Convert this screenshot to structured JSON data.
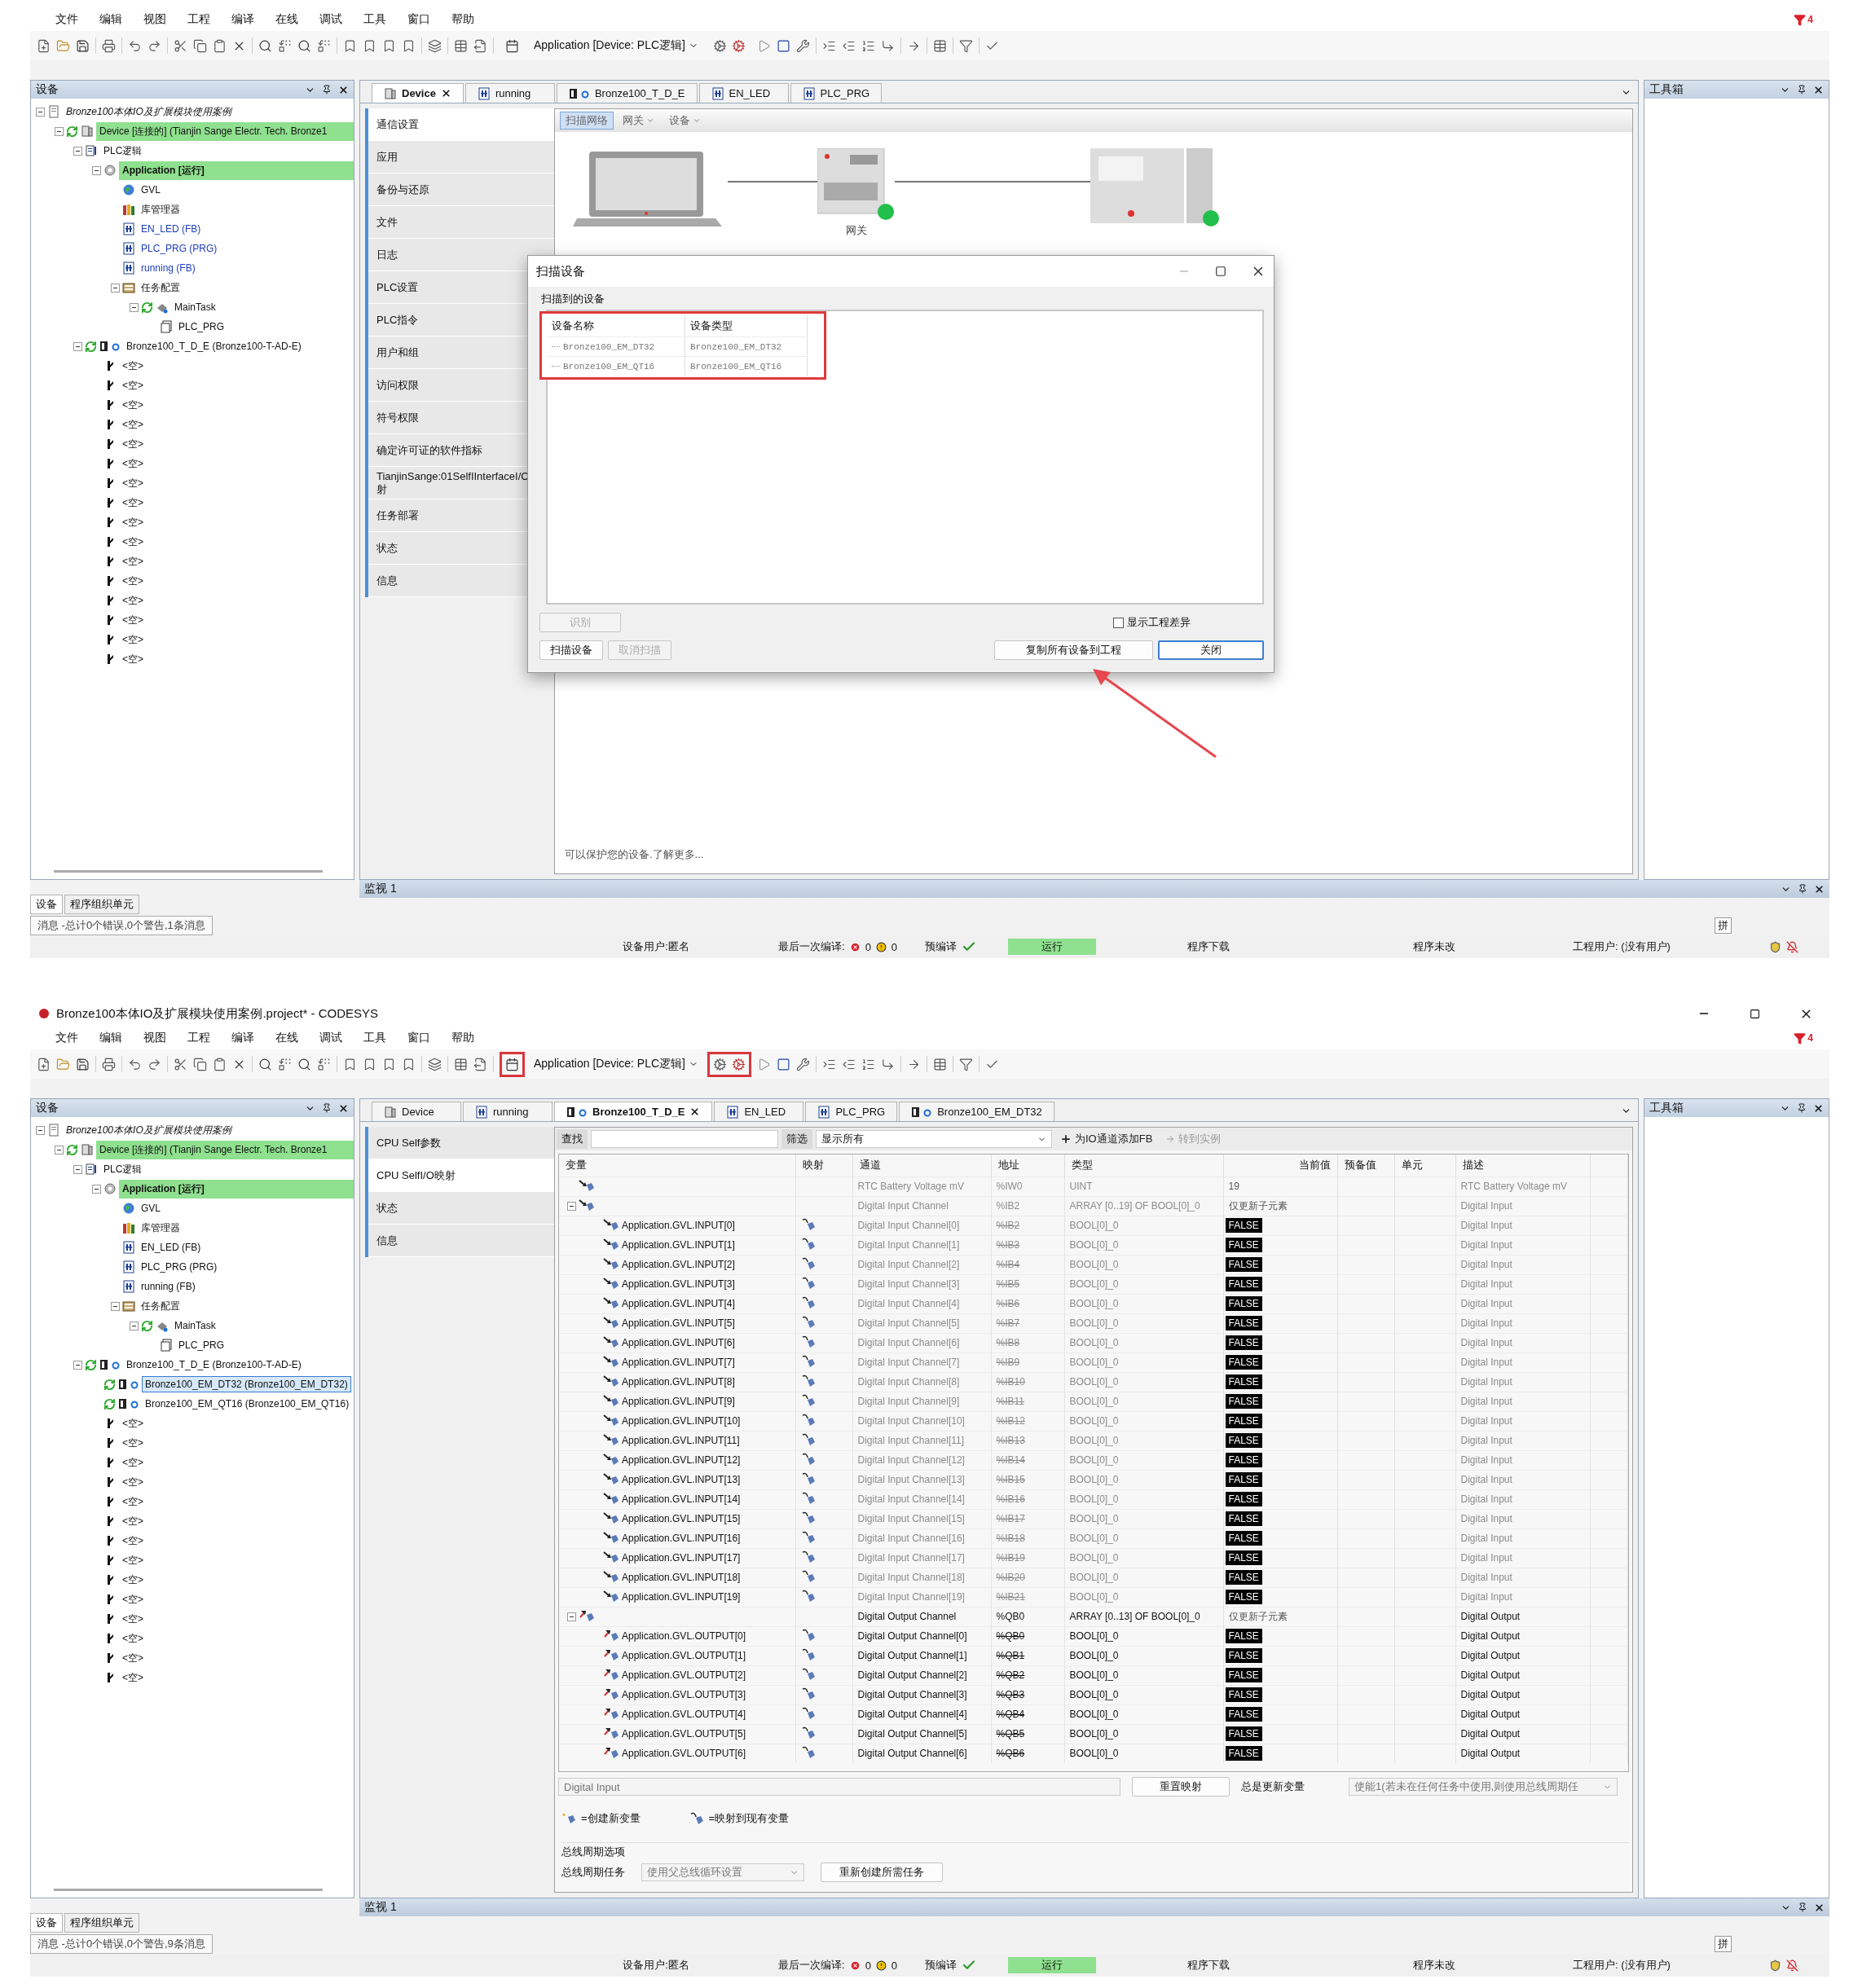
{
  "screens": [
    {
      "menu": [
        "文件",
        "编辑",
        "视图",
        "工程",
        "编译",
        "在线",
        "调试",
        "工具",
        "窗口",
        "帮助"
      ],
      "filter_badge": "4",
      "toolbar": {
        "application": "Application [Device: PLC逻辑]",
        "device_button_highlighted": false,
        "login_buttons_highlighted": false
      },
      "devices_panel": {
        "title": "设备",
        "tree": [
          {
            "label": "Bronze100本体IO及扩展模块使用案例",
            "kind": "project",
            "online": false,
            "highlighted": false,
            "selected": false,
            "children": [
              {
                "label": "Device [连接的] (Tianjin Sange Electr. Tech. Bronze1",
                "kind": "device",
                "online": true,
                "highlighted": true,
                "selected": false,
                "children": [
                  {
                    "label": "PLC逻辑",
                    "kind": "plc",
                    "online": false,
                    "highlighted": false,
                    "selected": false,
                    "children": [
                      {
                        "label": "Application [运行]",
                        "kind": "app",
                        "online": false,
                        "highlighted": true,
                        "selected": false,
                        "children": [
                          {
                            "label": "GVL",
                            "kind": "gvl",
                            "online": false,
                            "highlighted": false,
                            "selected": false
                          },
                          {
                            "label": "库管理器",
                            "kind": "lib",
                            "online": false,
                            "highlighted": false,
                            "selected": false
                          },
                          {
                            "label": "EN_LED (FB)",
                            "kind": "pou",
                            "online": false,
                            "highlighted": false,
                            "selected": false,
                            "color": "#1f3fbf"
                          },
                          {
                            "label": "PLC_PRG (PRG)",
                            "kind": "pou",
                            "online": false,
                            "highlighted": false,
                            "selected": false,
                            "color": "#1f3fbf"
                          },
                          {
                            "label": "running (FB)",
                            "kind": "pou",
                            "online": false,
                            "highlighted": false,
                            "selected": false,
                            "color": "#1f3fbf"
                          },
                          {
                            "label": "任务配置",
                            "kind": "taskcfg",
                            "online": false,
                            "highlighted": false,
                            "selected": false,
                            "children": [
                              {
                                "label": "MainTask",
                                "kind": "task",
                                "online": true,
                                "highlighted": false,
                                "selected": false,
                                "children": [
                                  {
                                    "label": "PLC_PRG",
                                    "kind": "prg",
                                    "online": false,
                                    "highlighted": false,
                                    "selected": false
                                  }
                                ]
                              }
                            ]
                          }
                        ]
                      }
                    ]
                  },
                  {
                    "label": "Bronze100_T_D_E (Bronze100-T-AD-E)",
                    "kind": "module",
                    "online": true,
                    "highlighted": false,
                    "selected": false,
                    "children": [
                      {
                        "label": "<空>",
                        "kind": "slot",
                        "online": false,
                        "highlighted": false,
                        "selected": false
                      },
                      {
                        "label": "<空>",
                        "kind": "slot",
                        "online": false,
                        "highlighted": false,
                        "selected": false
                      },
                      {
                        "label": "<空>",
                        "kind": "slot",
                        "online": false,
                        "highlighted": false,
                        "selected": false
                      },
                      {
                        "label": "<空>",
                        "kind": "slot",
                        "online": false,
                        "highlighted": false,
                        "selected": false
                      },
                      {
                        "label": "<空>",
                        "kind": "slot",
                        "online": false,
                        "highlighted": false,
                        "selected": false
                      },
                      {
                        "label": "<空>",
                        "kind": "slot",
                        "online": false,
                        "highlighted": false,
                        "selected": false
                      },
                      {
                        "label": "<空>",
                        "kind": "slot",
                        "online": false,
                        "highlighted": false,
                        "selected": false
                      },
                      {
                        "label": "<空>",
                        "kind": "slot",
                        "online": false,
                        "highlighted": false,
                        "selected": false
                      },
                      {
                        "label": "<空>",
                        "kind": "slot",
                        "online": false,
                        "highlighted": false,
                        "selected": false
                      },
                      {
                        "label": "<空>",
                        "kind": "slot",
                        "online": false,
                        "highlighted": false,
                        "selected": false
                      },
                      {
                        "label": "<空>",
                        "kind": "slot",
                        "online": false,
                        "highlighted": false,
                        "selected": false
                      },
                      {
                        "label": "<空>",
                        "kind": "slot",
                        "online": false,
                        "highlighted": false,
                        "selected": false
                      },
                      {
                        "label": "<空>",
                        "kind": "slot",
                        "online": false,
                        "highlighted": false,
                        "selected": false
                      },
                      {
                        "label": "<空>",
                        "kind": "slot",
                        "online": false,
                        "highlighted": false,
                        "selected": false
                      },
                      {
                        "label": "<空>",
                        "kind": "slot",
                        "online": false,
                        "highlighted": false,
                        "selected": false
                      },
                      {
                        "label": "<空>",
                        "kind": "slot",
                        "online": false,
                        "highlighted": false,
                        "selected": false
                      }
                    ]
                  }
                ]
              }
            ]
          }
        ],
        "tabs": [
          {
            "label": "设备",
            "selected": true
          },
          {
            "label": "程序组织单元",
            "selected": false
          }
        ]
      },
      "editor": {
        "kind": "communication",
        "tabs": [
          {
            "label": "Device",
            "kind": "device",
            "selected": true
          },
          {
            "label": "running",
            "kind": "pou",
            "selected": false
          },
          {
            "label": "Bronze100_T_D_E",
            "kind": "module",
            "selected": false
          },
          {
            "label": "EN_LED",
            "kind": "pou",
            "selected": false
          },
          {
            "label": "PLC_PRG",
            "kind": "pou",
            "selected": false
          }
        ],
        "nav": [
          {
            "label": "通信设置",
            "selected": true
          },
          {
            "label": "应用",
            "selected": false
          },
          {
            "label": "备份与还原",
            "selected": false
          },
          {
            "label": "文件",
            "selected": false
          },
          {
            "label": "日志",
            "selected": false
          },
          {
            "label": "PLC设置",
            "selected": false
          },
          {
            "label": "PLC指令",
            "selected": false
          },
          {
            "label": "用户和组",
            "selected": false
          },
          {
            "label": "访问权限",
            "selected": false
          },
          {
            "label": "符号权限",
            "selected": false
          },
          {
            "label": "确定许可证的软件指标",
            "selected": false
          },
          {
            "label": "TianjinSange:01SelfIInterfaceI/C\n射",
            "selected": false
          },
          {
            "label": "任务部署",
            "selected": false
          },
          {
            "label": "状态",
            "selected": false
          },
          {
            "label": "信息",
            "selected": false
          }
        ],
        "scan_toolbar": [
          {
            "label": "扫描网络",
            "selected": true,
            "dropdown": false
          },
          {
            "label": "网关",
            "selected": false,
            "dropdown": true
          },
          {
            "label": "设备",
            "selected": false,
            "dropdown": true
          }
        ],
        "gateway_label": "网关",
        "footer_note": "可以保护您的设备.了解更多...",
        "dialog": {
          "title": "扫描设备",
          "group": "扫描到的设备",
          "columns": [
            "设备名称",
            "设备类型"
          ],
          "rows": [
            [
              "Bronze100_EM_DT32",
              "Bronze100_EM_DT32"
            ],
            [
              "Bronze100_EM_QT16",
              "Bronze100_EM_QT16"
            ]
          ],
          "identify": {
            "label": "识别",
            "disabled": true
          },
          "show_diff": {
            "label": "显示工程差异",
            "checked": false
          },
          "left_buttons": [
            {
              "label": "扫描设备",
              "disabled": false,
              "default": false
            },
            {
              "label": "取消扫描",
              "disabled": true,
              "default": false
            }
          ],
          "right_buttons": [
            {
              "label": "复制所有设备到工程",
              "disabled": false,
              "default": false
            },
            {
              "label": "关闭",
              "disabled": false,
              "default": true
            }
          ]
        }
      },
      "toolbox": {
        "title": "工具箱"
      },
      "watch": {
        "title": "监视 1"
      },
      "messages": "消息 -总计0个错误,0个警告,1条消息",
      "ime": "拼",
      "status": {
        "device_user": "设备用户:匿名",
        "last_build": "最后一次编译:",
        "errors": "0",
        "warnings": "0",
        "precompile": "预编译",
        "run_state": "运行",
        "download": "程序下载",
        "change": "程序未改",
        "project_user": "工程用户: (没有用户)"
      }
    },
    {
      "title": "Bronze100本体IO及扩展模块使用案例.project* - CODESYS",
      "menu": [
        "文件",
        "编辑",
        "视图",
        "工程",
        "编译",
        "在线",
        "调试",
        "工具",
        "窗口",
        "帮助"
      ],
      "filter_badge": "4",
      "toolbar": {
        "application": "Application [Device: PLC逻辑]",
        "device_button_highlighted": true,
        "login_buttons_highlighted": true
      },
      "devices_panel": {
        "title": "设备",
        "tree": [
          {
            "label": "Bronze100本体IO及扩展模块使用案例",
            "kind": "project",
            "online": false,
            "highlighted": false,
            "selected": false,
            "children": [
              {
                "label": "Device [连接的] (Tianjin Sange Electr. Tech. Bronze1",
                "kind": "device",
                "online": true,
                "highlighted": true,
                "selected": false,
                "children": [
                  {
                    "label": "PLC逻辑",
                    "kind": "plc",
                    "online": false,
                    "highlighted": false,
                    "selected": false,
                    "children": [
                      {
                        "label": "Application [运行]",
                        "kind": "app",
                        "online": false,
                        "highlighted": true,
                        "selected": false,
                        "children": [
                          {
                            "label": "GVL",
                            "kind": "gvl",
                            "online": false,
                            "highlighted": false,
                            "selected": false
                          },
                          {
                            "label": "库管理器",
                            "kind": "lib",
                            "online": false,
                            "highlighted": false,
                            "selected": false
                          },
                          {
                            "label": "EN_LED (FB)",
                            "kind": "pou",
                            "online": false,
                            "highlighted": false,
                            "selected": false
                          },
                          {
                            "label": "PLC_PRG (PRG)",
                            "kind": "pou",
                            "online": false,
                            "highlighted": false,
                            "selected": false
                          },
                          {
                            "label": "running (FB)",
                            "kind": "pou",
                            "online": false,
                            "highlighted": false,
                            "selected": false
                          },
                          {
                            "label": "任务配置",
                            "kind": "taskcfg",
                            "online": false,
                            "highlighted": false,
                            "selected": false,
                            "children": [
                              {
                                "label": "MainTask",
                                "kind": "task",
                                "online": true,
                                "highlighted": false,
                                "selected": false,
                                "children": [
                                  {
                                    "label": "PLC_PRG",
                                    "kind": "prg",
                                    "online": false,
                                    "highlighted": false,
                                    "selected": false
                                  }
                                ]
                              }
                            ]
                          }
                        ]
                      }
                    ]
                  },
                  {
                    "label": "Bronze100_T_D_E (Bronze100-T-AD-E)",
                    "kind": "module",
                    "online": true,
                    "highlighted": false,
                    "selected": false,
                    "children": [
                      {
                        "label": "Bronze100_EM_DT32 (Bronze100_EM_DT32)",
                        "kind": "module",
                        "online": true,
                        "highlighted": false,
                        "selected": true
                      },
                      {
                        "label": "Bronze100_EM_QT16 (Bronze100_EM_QT16)",
                        "kind": "module",
                        "online": true,
                        "highlighted": false,
                        "selected": false
                      },
                      {
                        "label": "<空>",
                        "kind": "slot",
                        "online": false,
                        "highlighted": false,
                        "selected": false
                      },
                      {
                        "label": "<空>",
                        "kind": "slot",
                        "online": false,
                        "highlighted": false,
                        "selected": false
                      },
                      {
                        "label": "<空>",
                        "kind": "slot",
                        "online": false,
                        "highlighted": false,
                        "selected": false
                      },
                      {
                        "label": "<空>",
                        "kind": "slot",
                        "online": false,
                        "highlighted": false,
                        "selected": false
                      },
                      {
                        "label": "<空>",
                        "kind": "slot",
                        "online": false,
                        "highlighted": false,
                        "selected": false
                      },
                      {
                        "label": "<空>",
                        "kind": "slot",
                        "online": false,
                        "highlighted": false,
                        "selected": false
                      },
                      {
                        "label": "<空>",
                        "kind": "slot",
                        "online": false,
                        "highlighted": false,
                        "selected": false
                      },
                      {
                        "label": "<空>",
                        "kind": "slot",
                        "online": false,
                        "highlighted": false,
                        "selected": false
                      },
                      {
                        "label": "<空>",
                        "kind": "slot",
                        "online": false,
                        "highlighted": false,
                        "selected": false
                      },
                      {
                        "label": "<空>",
                        "kind": "slot",
                        "online": false,
                        "highlighted": false,
                        "selected": false
                      },
                      {
                        "label": "<空>",
                        "kind": "slot",
                        "online": false,
                        "highlighted": false,
                        "selected": false
                      },
                      {
                        "label": "<空>",
                        "kind": "slot",
                        "online": false,
                        "highlighted": false,
                        "selected": false
                      },
                      {
                        "label": "<空>",
                        "kind": "slot",
                        "online": false,
                        "highlighted": false,
                        "selected": false
                      },
                      {
                        "label": "<空>",
                        "kind": "slot",
                        "online": false,
                        "highlighted": false,
                        "selected": false
                      }
                    ]
                  }
                ]
              }
            ]
          }
        ],
        "tabs": [
          {
            "label": "设备",
            "selected": true
          },
          {
            "label": "程序组织单元",
            "selected": false
          }
        ]
      },
      "editor": {
        "kind": "io_mapping",
        "tabs": [
          {
            "label": "Device",
            "kind": "device",
            "selected": false
          },
          {
            "label": "running",
            "kind": "pou",
            "selected": false
          },
          {
            "label": "Bronze100_T_D_E",
            "kind": "module",
            "selected": true
          },
          {
            "label": "EN_LED",
            "kind": "pou",
            "selected": false
          },
          {
            "label": "PLC_PRG",
            "kind": "pou",
            "selected": false
          },
          {
            "label": "Bronze100_EM_DT32",
            "kind": "module",
            "selected": false
          }
        ],
        "nav": [
          {
            "label": "CPU Self参数",
            "selected": false
          },
          {
            "label": "CPU SelfI/O映射",
            "selected": true
          },
          {
            "label": "状态",
            "selected": false
          },
          {
            "label": "信息",
            "selected": false
          }
        ],
        "filter": {
          "find_label": "查找",
          "filter_label": "筛选",
          "filter_value": "显示所有",
          "add_fb": "为IO通道添加FB",
          "goto_instance": {
            "label": "转到实例",
            "disabled": true
          }
        },
        "columns": [
          "变量",
          "映射",
          "通道",
          "地址",
          "类型",
          "当前值",
          "预备值",
          "单元",
          "描述"
        ],
        "rows": [
          {
            "kind": "input",
            "mapped": false,
            "channel": "RTC Battery Voltage mV",
            "address": "%IW0",
            "address_struck": false,
            "type": "UINT",
            "current": "19",
            "current_boxed": false,
            "description": "RTC Battery Voltage mV",
            "dimmed": true
          },
          {
            "kind": "input",
            "mapped": false,
            "channel": "Digital Input Channel",
            "address": "%IB2",
            "address_struck": false,
            "type": "ARRAY [0..19] OF BOOL[0]_0",
            "current": "仅更新子元素",
            "current_boxed": false,
            "description": "Digital Input",
            "dimmed": true,
            "children": [
              {
                "variable": "Application.GVL.INPUT[0]",
                "kind": "input",
                "mapped": true,
                "channel": "Digital Input Channel[0]",
                "address": "%IB2",
                "address_struck": true,
                "type": "BOOL[0]_0",
                "current": "FALSE",
                "current_boxed": true,
                "description": "Digital Input",
                "dimmed": true
              },
              {
                "variable": "Application.GVL.INPUT[1]",
                "kind": "input",
                "mapped": true,
                "channel": "Digital Input Channel[1]",
                "address": "%IB3",
                "address_struck": true,
                "type": "BOOL[0]_0",
                "current": "FALSE",
                "current_boxed": true,
                "description": "Digital Input",
                "dimmed": true
              },
              {
                "variable": "Application.GVL.INPUT[2]",
                "kind": "input",
                "mapped": true,
                "channel": "Digital Input Channel[2]",
                "address": "%IB4",
                "address_struck": true,
                "type": "BOOL[0]_0",
                "current": "FALSE",
                "current_boxed": true,
                "description": "Digital Input",
                "dimmed": true
              },
              {
                "variable": "Application.GVL.INPUT[3]",
                "kind": "input",
                "mapped": true,
                "channel": "Digital Input Channel[3]",
                "address": "%IB5",
                "address_struck": true,
                "type": "BOOL[0]_0",
                "current": "FALSE",
                "current_boxed": true,
                "description": "Digital Input",
                "dimmed": true
              },
              {
                "variable": "Application.GVL.INPUT[4]",
                "kind": "input",
                "mapped": true,
                "channel": "Digital Input Channel[4]",
                "address": "%IB6",
                "address_struck": true,
                "type": "BOOL[0]_0",
                "current": "FALSE",
                "current_boxed": true,
                "description": "Digital Input",
                "dimmed": true
              },
              {
                "variable": "Application.GVL.INPUT[5]",
                "kind": "input",
                "mapped": true,
                "channel": "Digital Input Channel[5]",
                "address": "%IB7",
                "address_struck": true,
                "type": "BOOL[0]_0",
                "current": "FALSE",
                "current_boxed": true,
                "description": "Digital Input",
                "dimmed": true
              },
              {
                "variable": "Application.GVL.INPUT[6]",
                "kind": "input",
                "mapped": true,
                "channel": "Digital Input Channel[6]",
                "address": "%IB8",
                "address_struck": true,
                "type": "BOOL[0]_0",
                "current": "FALSE",
                "current_boxed": true,
                "description": "Digital Input",
                "dimmed": true
              },
              {
                "variable": "Application.GVL.INPUT[7]",
                "kind": "input",
                "mapped": true,
                "channel": "Digital Input Channel[7]",
                "address": "%IB9",
                "address_struck": true,
                "type": "BOOL[0]_0",
                "current": "FALSE",
                "current_boxed": true,
                "description": "Digital Input",
                "dimmed": true
              },
              {
                "variable": "Application.GVL.INPUT[8]",
                "kind": "input",
                "mapped": true,
                "channel": "Digital Input Channel[8]",
                "address": "%IB10",
                "address_struck": true,
                "type": "BOOL[0]_0",
                "current": "FALSE",
                "current_boxed": true,
                "description": "Digital Input",
                "dimmed": true
              },
              {
                "variable": "Application.GVL.INPUT[9]",
                "kind": "input",
                "mapped": true,
                "channel": "Digital Input Channel[9]",
                "address": "%IB11",
                "address_struck": true,
                "type": "BOOL[0]_0",
                "current": "FALSE",
                "current_boxed": true,
                "description": "Digital Input",
                "dimmed": true
              },
              {
                "variable": "Application.GVL.INPUT[10]",
                "kind": "input",
                "mapped": true,
                "channel": "Digital Input Channel[10]",
                "address": "%IB12",
                "address_struck": true,
                "type": "BOOL[0]_0",
                "current": "FALSE",
                "current_boxed": true,
                "description": "Digital Input",
                "dimmed": true
              },
              {
                "variable": "Application.GVL.INPUT[11]",
                "kind": "input",
                "mapped": true,
                "channel": "Digital Input Channel[11]",
                "address": "%IB13",
                "address_struck": true,
                "type": "BOOL[0]_0",
                "current": "FALSE",
                "current_boxed": true,
                "description": "Digital Input",
                "dimmed": true
              },
              {
                "variable": "Application.GVL.INPUT[12]",
                "kind": "input",
                "mapped": true,
                "channel": "Digital Input Channel[12]",
                "address": "%IB14",
                "address_struck": true,
                "type": "BOOL[0]_0",
                "current": "FALSE",
                "current_boxed": true,
                "description": "Digital Input",
                "dimmed": true
              },
              {
                "variable": "Application.GVL.INPUT[13]",
                "kind": "input",
                "mapped": true,
                "channel": "Digital Input Channel[13]",
                "address": "%IB15",
                "address_struck": true,
                "type": "BOOL[0]_0",
                "current": "FALSE",
                "current_boxed": true,
                "description": "Digital Input",
                "dimmed": true
              },
              {
                "variable": "Application.GVL.INPUT[14]",
                "kind": "input",
                "mapped": true,
                "channel": "Digital Input Channel[14]",
                "address": "%IB16",
                "address_struck": true,
                "type": "BOOL[0]_0",
                "current": "FALSE",
                "current_boxed": true,
                "description": "Digital Input",
                "dimmed": true
              },
              {
                "variable": "Application.GVL.INPUT[15]",
                "kind": "input",
                "mapped": true,
                "channel": "Digital Input Channel[15]",
                "address": "%IB17",
                "address_struck": true,
                "type": "BOOL[0]_0",
                "current": "FALSE",
                "current_boxed": true,
                "description": "Digital Input",
                "dimmed": true
              },
              {
                "variable": "Application.GVL.INPUT[16]",
                "kind": "input",
                "mapped": true,
                "channel": "Digital Input Channel[16]",
                "address": "%IB18",
                "address_struck": true,
                "type": "BOOL[0]_0",
                "current": "FALSE",
                "current_boxed": true,
                "description": "Digital Input",
                "dimmed": true
              },
              {
                "variable": "Application.GVL.INPUT[17]",
                "kind": "input",
                "mapped": true,
                "channel": "Digital Input Channel[17]",
                "address": "%IB19",
                "address_struck": true,
                "type": "BOOL[0]_0",
                "current": "FALSE",
                "current_boxed": true,
                "description": "Digital Input",
                "dimmed": true
              },
              {
                "variable": "Application.GVL.INPUT[18]",
                "kind": "input",
                "mapped": true,
                "channel": "Digital Input Channel[18]",
                "address": "%IB20",
                "address_struck": true,
                "type": "BOOL[0]_0",
                "current": "FALSE",
                "current_boxed": true,
                "description": "Digital Input",
                "dimmed": true
              },
              {
                "variable": "Application.GVL.INPUT[19]",
                "kind": "input",
                "mapped": true,
                "channel": "Digital Input Channel[19]",
                "address": "%IB21",
                "address_struck": true,
                "type": "BOOL[0]_0",
                "current": "FALSE",
                "current_boxed": true,
                "description": "Digital Input",
                "dimmed": true
              }
            ]
          },
          {
            "kind": "output",
            "mapped": false,
            "channel": "Digital Output Channel",
            "address": "%QB0",
            "address_struck": false,
            "type": "ARRAY [0..13] OF BOOL[0]_0",
            "current": "仅更新子元素",
            "current_boxed": false,
            "description": "Digital Output",
            "dimmed": false,
            "children": [
              {
                "variable": "Application.GVL.OUTPUT[0]",
                "kind": "output",
                "mapped": true,
                "channel": "Digital Output Channel[0]",
                "address": "%QB0",
                "address_struck": true,
                "type": "BOOL[0]_0",
                "current": "FALSE",
                "current_boxed": true,
                "description": "Digital Output",
                "dimmed": false
              },
              {
                "variable": "Application.GVL.OUTPUT[1]",
                "kind": "output",
                "mapped": true,
                "channel": "Digital Output Channel[1]",
                "address": "%QB1",
                "address_struck": true,
                "type": "BOOL[0]_0",
                "current": "FALSE",
                "current_boxed": true,
                "description": "Digital Output",
                "dimmed": false
              },
              {
                "variable": "Application.GVL.OUTPUT[2]",
                "kind": "output",
                "mapped": true,
                "channel": "Digital Output Channel[2]",
                "address": "%QB2",
                "address_struck": true,
                "type": "BOOL[0]_0",
                "current": "FALSE",
                "current_boxed": true,
                "description": "Digital Output",
                "dimmed": false
              },
              {
                "variable": "Application.GVL.OUTPUT[3]",
                "kind": "output",
                "mapped": true,
                "channel": "Digital Output Channel[3]",
                "address": "%QB3",
                "address_struck": true,
                "type": "BOOL[0]_0",
                "current": "FALSE",
                "current_boxed": true,
                "description": "Digital Output",
                "dimmed": false
              },
              {
                "variable": "Application.GVL.OUTPUT[4]",
                "kind": "output",
                "mapped": true,
                "channel": "Digital Output Channel[4]",
                "address": "%QB4",
                "address_struck": true,
                "type": "BOOL[0]_0",
                "current": "FALSE",
                "current_boxed": true,
                "description": "Digital Output",
                "dimmed": false
              },
              {
                "variable": "Application.GVL.OUTPUT[5]",
                "kind": "output",
                "mapped": true,
                "channel": "Digital Output Channel[5]",
                "address": "%QB5",
                "address_struck": true,
                "type": "BOOL[0]_0",
                "current": "FALSE",
                "current_boxed": true,
                "description": "Digital Output",
                "dimmed": false
              },
              {
                "variable": "Application.GVL.OUTPUT[6]",
                "kind": "output",
                "mapped": true,
                "channel": "Digital Output Channel[6]",
                "address": "%QB6",
                "address_struck": true,
                "type": "BOOL[0]_0",
                "current": "FALSE",
                "current_boxed": true,
                "description": "Digital Output",
                "dimmed": false
              }
            ]
          }
        ],
        "footer": {
          "description": "Digital Input",
          "reset": "重置映射",
          "always_update": "总是更新变量",
          "always_update_value": "使能1(若未在任何任务中使用,则使用总线周期任"
        },
        "legend": [
          {
            "kind": "create",
            "label": "=创建新变量"
          },
          {
            "kind": "map",
            "label": "=映射到现有变量"
          }
        ],
        "bus_cycle": {
          "title": "总线周期选项",
          "label": "总线周期任务",
          "value": "使用父总线循环设置",
          "button": "重新创建所需任务"
        }
      },
      "toolbox": {
        "title": "工具箱"
      },
      "watch": {
        "title": "监视 1"
      },
      "messages": "消息 -总计0个错误,0个警告,9条消息",
      "ime": "拼",
      "status": {
        "device_user": "设备用户:匿名",
        "last_build": "最后一次编译:",
        "errors": "0",
        "warnings": "0",
        "precompile": "预编译",
        "run_state": "运行",
        "download": "程序下载",
        "change": "程序未改",
        "project_user": "工程用户: (没有用户)"
      }
    }
  ]
}
